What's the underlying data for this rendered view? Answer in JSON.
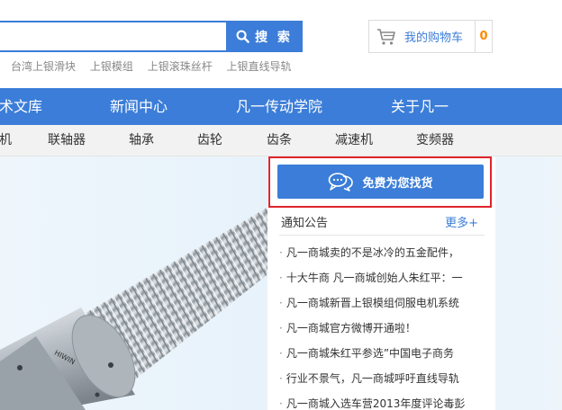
{
  "header": {
    "search": {
      "value": "",
      "button_label": "搜 索"
    },
    "hot_keywords": [
      "台湾上银滑块",
      "上银模组",
      "上银滚珠丝杆",
      "上银直线导轨"
    ],
    "cart": {
      "label": "我的购物车",
      "count": "0"
    }
  },
  "main_nav": [
    "术文库",
    "新闻中心",
    "凡一传动学院",
    "关于凡一"
  ],
  "category_nav": [
    "机",
    "联轴器",
    "轴承",
    "齿轮",
    "齿条",
    "减速机",
    "变频器"
  ],
  "banner": {
    "product_brand": "HIWIN"
  },
  "side_panel": {
    "find_goods_label": "免费为您找货",
    "notice": {
      "title": "通知公告",
      "more_label": "更多+",
      "items": [
        "凡一商城卖的不是冰冷的五金配件，",
        "十大牛商 凡一商城创始人朱红平：一",
        "凡一商城新晋上银模组伺服电机系统",
        "凡一商城官方微博开通啦！",
        "凡一商城朱红平参选”中国电子商务",
        "行业不景气，凡一商城呼吁直线导轨",
        "凡一商城入选车营2013年度评论毒彭"
      ]
    }
  },
  "colors": {
    "brand_blue": "#3b7dd8",
    "highlight_red": "#e0242b",
    "cart_count_orange": "#ff8a00"
  }
}
